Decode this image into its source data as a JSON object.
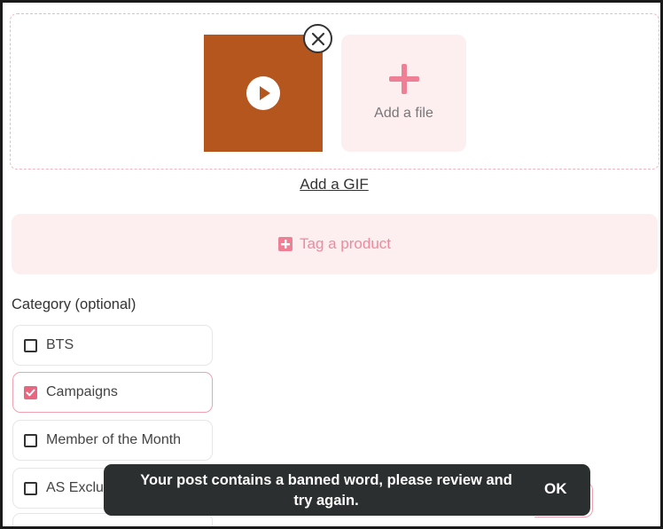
{
  "upload": {
    "add_file_label": "Add a file",
    "add_gif_label": "Add a GIF",
    "video_thumb_color": "#b5561f"
  },
  "tag_product": {
    "label": "Tag a product",
    "icon": "plus-square-icon"
  },
  "category": {
    "heading": "Category (optional)",
    "items": [
      {
        "label": "BTS",
        "checked": false
      },
      {
        "label": "Campaigns",
        "checked": true
      },
      {
        "label": "Member of the Month",
        "checked": false
      },
      {
        "label": "AS Exclu",
        "checked": false
      }
    ]
  },
  "toast": {
    "message_line1": "Your post contains a banned word, please review and",
    "message_line2": "try again.",
    "ok_label": "OK"
  },
  "colors": {
    "accent": "#e8667f",
    "accent_light": "#fdeef0",
    "toast_bg": "#2b2f2f"
  }
}
